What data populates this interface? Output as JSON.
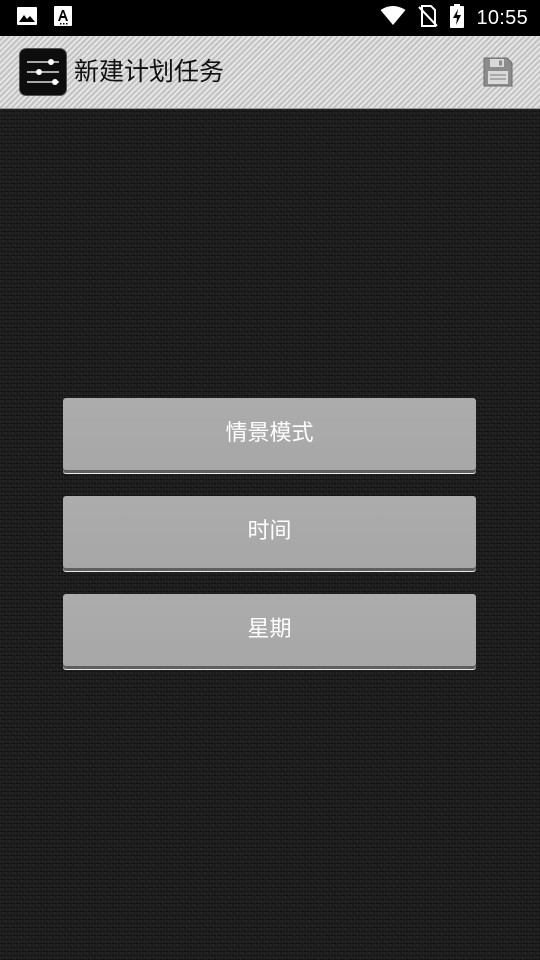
{
  "status_bar": {
    "time": "10:55",
    "left_icons": [
      "image-icon",
      "font-a-icon"
    ],
    "right_icons": [
      "wifi-icon",
      "no-sim-icon",
      "battery-charging-icon"
    ]
  },
  "action_bar": {
    "title": "新建计划任务",
    "app_icon": "equalizer-sliders-icon",
    "action_icon": "save-floppy-icon"
  },
  "buttons": [
    {
      "label": "情景模式"
    },
    {
      "label": "时间"
    },
    {
      "label": "星期"
    }
  ],
  "colors": {
    "background": "#1c1c1c",
    "action_bar": "#cfcfcf",
    "button": "#a9a9a9",
    "button_text": "#ffffff"
  }
}
